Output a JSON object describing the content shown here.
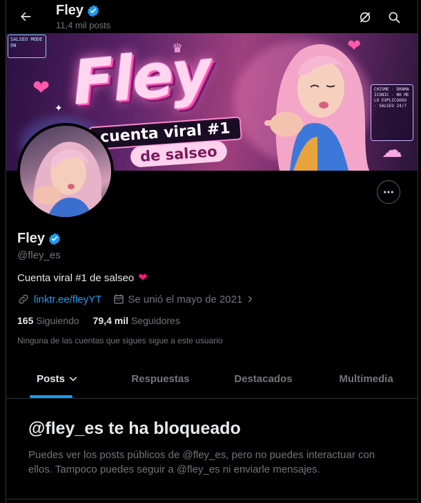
{
  "header": {
    "name": "Fley",
    "post_count": "11,4 mil posts"
  },
  "banner": {
    "sign_text": "SALSEO MODE ON",
    "title": "Fley",
    "ribbon": "cuenta viral #1",
    "tag": "de salseo",
    "list_text": "CHISME · DRAMA ICONIC · NO ME LO EXPLICOOOO · SALSEO 24/7"
  },
  "profile": {
    "name": "Fley",
    "handle": "@fley_es",
    "bio": "Cuenta viral #1 de salseo",
    "link": "linktr.ee/fleyYT",
    "joined": "Se unió el mayo de 2021",
    "following_count": "165",
    "following_label": "Siguiendo",
    "followers_count": "79,4 mil",
    "followers_label": "Seguidores",
    "followed_by": "Ninguna de las cuentas que sigues sigue a este usuario"
  },
  "tabs": [
    {
      "label": "Posts"
    },
    {
      "label": "Respuestas"
    },
    {
      "label": "Destacados"
    },
    {
      "label": "Multimedia"
    }
  ],
  "blocked": {
    "title": "@fley_es te ha bloqueado",
    "text": "Puedes ver los posts públicos de @fley_es, pero no puedes interactuar con ellos. Tampoco puedes seguir a @fley_es ni enviarle mensajes."
  },
  "colors": {
    "accent": "#1d9bf0",
    "muted": "#71767b",
    "text": "#e7e9ea",
    "heart": "#f91880"
  }
}
